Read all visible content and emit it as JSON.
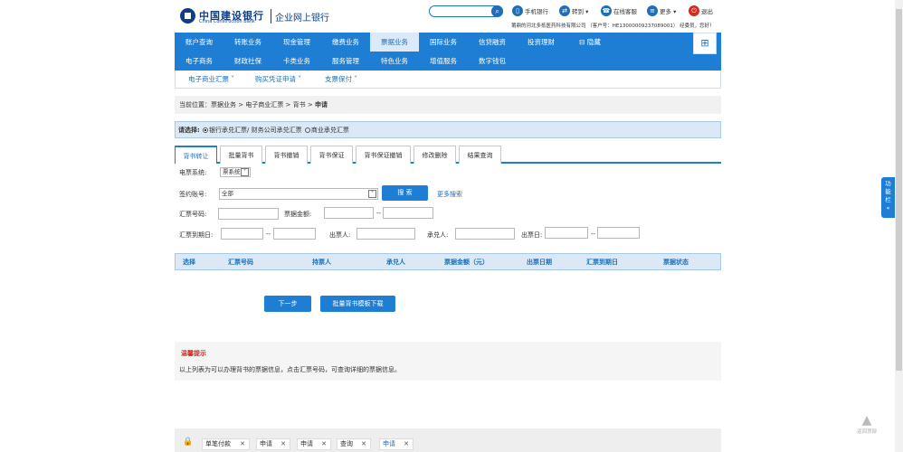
{
  "brand": {
    "cn": "中国建设银行",
    "en": "China Construction Bank",
    "sub": "企业网上银行"
  },
  "top": {
    "mobile": "手机银行",
    "switch": "转到 ▾",
    "service": "在线客服",
    "more": "更多 ▾",
    "logout": "退出",
    "customer": "莆鼎的河北多抵医药科技有限公司 （客户号：HE13000009237089001）  经委员，您好！"
  },
  "nav": {
    "row1": [
      "账户查询",
      "转账业务",
      "现金管理",
      "缴费业务",
      "票据业务",
      "国际业务",
      "信贷融资",
      "投资理财",
      "隐藏"
    ],
    "row2": [
      "电子商务",
      "财政社保",
      "卡类业务",
      "服务管理",
      "特色业务",
      "增值服务",
      "数字钱包"
    ]
  },
  "subnav": [
    "电子商业汇票 ˅",
    "购买凭证申请 ˅",
    "支票保付 ˅"
  ],
  "crumb": "当前位置：票据业务 > 电子商业汇票 > 背书 > ",
  "crumb_last": "申请",
  "choose": {
    "label": "请选择:",
    "opt1": "银行承兑汇票/ 财务公司承兑汇票",
    "opt2": "商业承兑汇票"
  },
  "tabs": [
    "背书转让",
    "批量背书",
    "背书撤销",
    "背书保证",
    "背书保证撤销",
    "修改删除",
    "结果查询"
  ],
  "form": {
    "system_label": "电票系统:",
    "system_value": "票系统",
    "account_label": "签约账号:",
    "account_value": "全部",
    "search_btn": "搜 索",
    "more_search": "更多搜索",
    "bill_no": "汇票号码:",
    "amount": "票据金额:",
    "dash": "--",
    "due": "汇票到期日:",
    "drawer": "出票人:",
    "acceptor": "承兑人:",
    "issue_date": "出票日:"
  },
  "table": {
    "headers": [
      "选择",
      "汇票号码",
      "持票人",
      "承兑人",
      "票据金额（元）",
      "出票日期",
      "汇票到期日",
      "票据状态"
    ]
  },
  "buttons": {
    "next": "下一步",
    "batch": "批量背书模板下载"
  },
  "tip": {
    "title": "温馨提示",
    "text": "以上列表为可以办理背书的票据信息，点击汇票号码，可查询详细的票据信息。"
  },
  "bottom_tabs": [
    "单笔付款",
    "申请",
    "申请",
    "查询",
    "申请"
  ],
  "side": "功能栏",
  "totop": "返回顶部"
}
